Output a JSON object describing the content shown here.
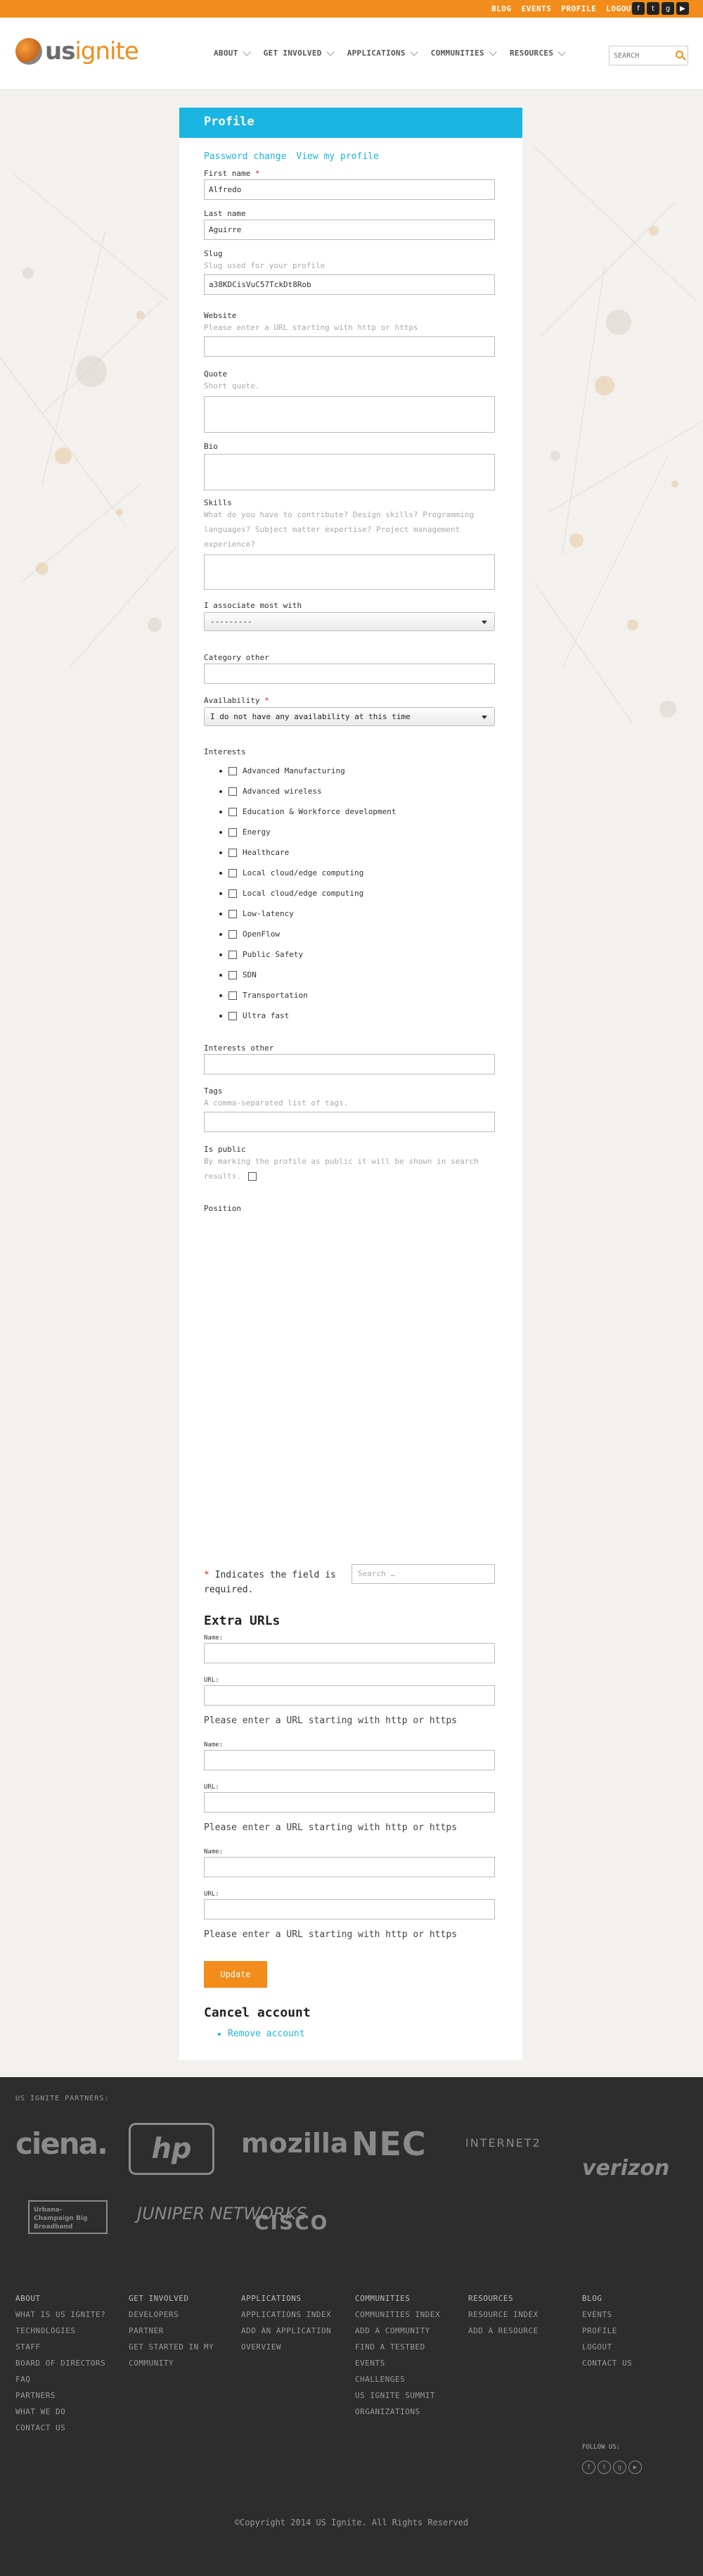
{
  "topbar": {
    "links": [
      "BLOG",
      "EVENTS",
      "PROFILE",
      "LOGOUT"
    ],
    "social": [
      {
        "icon": "facebook-icon",
        "glyph": "f"
      },
      {
        "icon": "twitter-icon",
        "glyph": "t"
      },
      {
        "icon": "googleplus-icon",
        "glyph": "g"
      },
      {
        "icon": "youtube-icon",
        "glyph": "▶"
      }
    ]
  },
  "header": {
    "logo_us": "us",
    "logo_ignite": "ignite",
    "nav": [
      "ABOUT",
      "GET INVOLVED",
      "APPLICATIONS",
      "COMMUNITIES",
      "RESOURCES"
    ],
    "search_placeholder": "SEARCH"
  },
  "profile": {
    "title": "Profile",
    "tabs": [
      "Password change",
      "View my profile"
    ],
    "first_name": {
      "label": "First name",
      "value": "Alfredo"
    },
    "last_name": {
      "label": "Last name",
      "value": "Aguirre"
    },
    "slug": {
      "label": "Slug",
      "help": "Slug used for your profile",
      "value": "a38KDCisVuC57TckDt8Rob"
    },
    "website": {
      "label": "Website",
      "help": "Please enter a URL starting with http or https",
      "value": ""
    },
    "quote": {
      "label": "Quote",
      "help": "Short quote."
    },
    "bio": {
      "label": "Bio"
    },
    "skills": {
      "label": "Skills",
      "help_lines": [
        "What do you have to contribute? Design skills? Programming",
        "languages? Subject matter expertise? Project management",
        "experience?"
      ]
    },
    "associate": {
      "label": "I associate most with",
      "value": "---------"
    },
    "category_other": {
      "label": "Category other",
      "value": ""
    },
    "availability": {
      "label": "Availability",
      "value": "I do not have any availability at this time"
    },
    "interests_label": "Interests",
    "interests": [
      "Advanced Manufacturing",
      "Advanced wireless",
      "Education & Workforce development",
      "Energy",
      "Healthcare",
      "Local cloud/edge computing",
      "Local cloud/edge computing",
      "Low-latency",
      "OpenFlow",
      "Public Safety",
      "SDN",
      "Transportation",
      "Ultra fast"
    ],
    "interests_other": {
      "label": "Interests other",
      "value": ""
    },
    "tags": {
      "label": "Tags",
      "help": "A comma-separated list of tags.",
      "value": ""
    },
    "is_public": {
      "label": "Is public",
      "help_lines": [
        "By marking the profile as public it will be shown in search",
        "results."
      ]
    },
    "position": {
      "label": "Position"
    },
    "required_note_star": "*",
    "required_note": " Indicates the field is required.",
    "search_placeholder": "Search …"
  },
  "extra_urls": {
    "title": "Extra URLs",
    "name_label": "Name:",
    "url_label": "URL:",
    "url_help": "Please enter a URL starting with http or https",
    "count": 3
  },
  "update_label": "Update",
  "cancel": {
    "title": "Cancel account",
    "remove_label": "Remove account"
  },
  "footer": {
    "partners_label": "US IGNITE PARTNERS:",
    "partners": [
      "ciena.",
      "hp",
      "mozilla",
      "NEC",
      "INTERNET2",
      "verizon",
      "Urbana-Champaign Big Broadband",
      "JUNIPER NETWORKS",
      "CISCO"
    ],
    "columns": [
      {
        "heading": "ABOUT",
        "items": [
          "WHAT IS US IGNITE?",
          "TECHNOLOGIES",
          "STAFF",
          "BOARD OF DIRECTORS",
          "FAQ",
          "PARTNERS",
          "WHAT WE DO",
          "CONTACT US"
        ]
      },
      {
        "heading": "GET INVOLVED",
        "items": [
          "DEVELOPERS",
          "PARTNER",
          "GET STARTED IN MY",
          "COMMUNITY"
        ]
      },
      {
        "heading": "APPLICATIONS",
        "items": [
          "APPLICATIONS INDEX",
          "ADD AN APPLICATION",
          "OVERVIEW"
        ]
      },
      {
        "heading": "COMMUNITIES",
        "items": [
          "COMMUNITIES INDEX",
          "ADD A COMMUNITY",
          "FIND A TESTBED",
          "EVENTS",
          "CHALLENGES",
          "US IGNITE SUMMIT",
          "ORGANIZATIONS"
        ]
      },
      {
        "heading": "RESOURCES",
        "items": [
          "RESOURCE INDEX",
          "ADD A RESOURCE"
        ]
      },
      {
        "heading": "BLOG",
        "items": [
          "EVENTS",
          "PROFILE",
          "LOGOUT",
          "CONTACT US"
        ]
      }
    ],
    "follow_label": "FOLLOW US:",
    "follow_icons": [
      {
        "icon": "facebook-icon",
        "glyph": "f"
      },
      {
        "icon": "twitter-icon",
        "glyph": "t"
      },
      {
        "icon": "googleplus-icon",
        "glyph": "g"
      },
      {
        "icon": "youtube-icon",
        "glyph": "▶"
      }
    ],
    "copyright": "©Copyright 2014 US Ignite. All Rights Reserved"
  },
  "colors": {
    "accent": "#f28c1a",
    "link": "#1ab5e0",
    "footer_bg": "#2d2d2d",
    "page_bg": "#f2f1ee"
  }
}
